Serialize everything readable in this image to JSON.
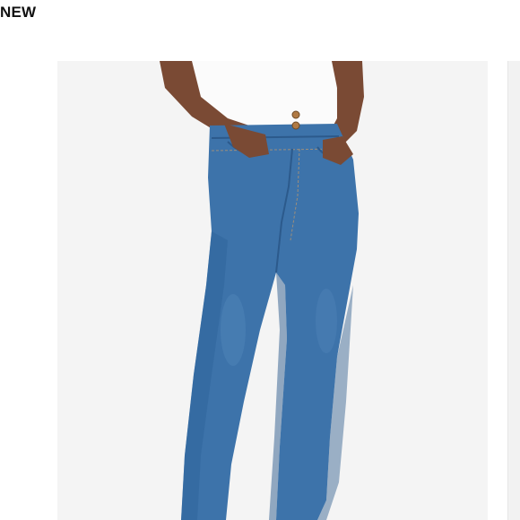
{
  "badge": {
    "text": "NEW"
  },
  "product_image": {
    "subject": "jeans-photo",
    "colors": {
      "backdrop": "#f4f4f4",
      "denim": "#3d73aa",
      "denim_shadow": "#2c5a8c",
      "skin": "#7a4a34",
      "top": "#fafafa",
      "rivet": "#b07a44"
    }
  }
}
